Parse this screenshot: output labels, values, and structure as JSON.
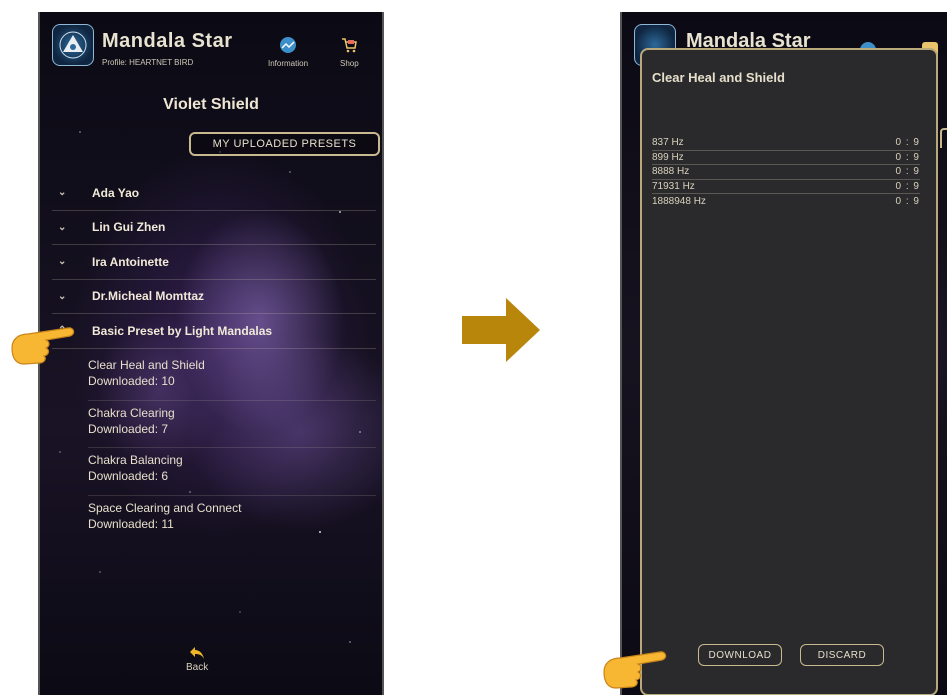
{
  "left_screen": {
    "app_title": "Mandala Star",
    "profile": "Profile: HEARTNET BIRD",
    "info_label": "Information",
    "shop_label": "Shop",
    "screen_title": "Violet Shield",
    "presets_button": "MY UPLOADED PRESETS",
    "authors": [
      {
        "name": "Ada Yao",
        "icon": "chevron-down-icon"
      },
      {
        "name": "Lin Gui Zhen",
        "icon": "chevron-down-icon"
      },
      {
        "name": "Ira Antoinette",
        "icon": "chevron-down-icon"
      },
      {
        "name": "Dr.Micheal Momttaz",
        "icon": "chevron-down-icon"
      },
      {
        "name": "Basic Preset by Light Mandalas",
        "icon": "chevron-up-icon"
      }
    ],
    "presets": [
      {
        "title": "Clear Heal and Shield",
        "downloads": "Downloaded: 10"
      },
      {
        "title": "Chakra Clearing",
        "downloads": "Downloaded: 7"
      },
      {
        "title": "Chakra Balancing",
        "downloads": "Downloaded: 6"
      },
      {
        "title": "Space Clearing and Connect",
        "downloads": "Downloaded: 11"
      }
    ],
    "back_label": "Back"
  },
  "right_screen": {
    "app_title": "Mandala Star",
    "modal": {
      "title": "Clear Heal and Shield",
      "frequencies": [
        {
          "freq": "837 Hz",
          "time": "0 : 9"
        },
        {
          "freq": "899 Hz",
          "time": "0 : 9"
        },
        {
          "freq": "8888 Hz",
          "time": "0 : 9"
        },
        {
          "freq": "71931 Hz",
          "time": "0 : 9"
        },
        {
          "freq": "1888948 Hz",
          "time": "0 : 9"
        }
      ],
      "download_label": "DOWNLOAD",
      "discard_label": "DISCARD"
    }
  },
  "colors": {
    "accent_gold": "#c9b98f",
    "arrow_gold": "#b8860b",
    "modal_bg": "#2a2a2c",
    "hand_yellow": "#f7b733"
  }
}
